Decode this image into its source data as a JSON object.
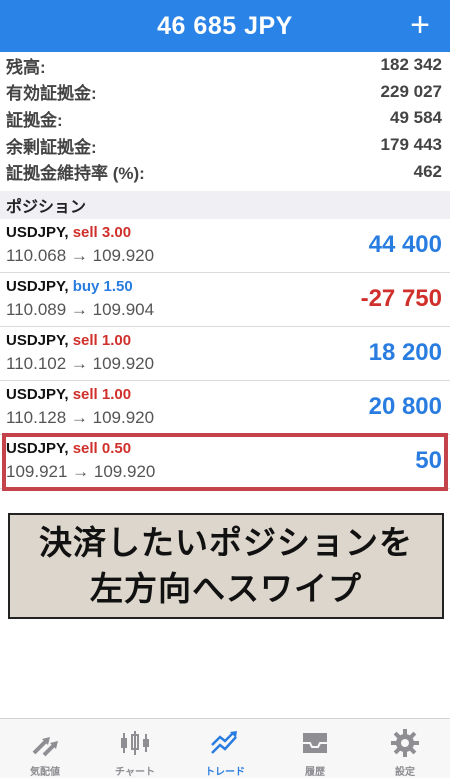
{
  "header": {
    "title": "46 685 JPY",
    "plus": "+"
  },
  "summary": [
    {
      "label": "残高:",
      "value": "182 342"
    },
    {
      "label": "有効証拠金:",
      "value": "229 027"
    },
    {
      "label": "証拠金:",
      "value": "49 584"
    },
    {
      "label": "余剰証拠金:",
      "value": "179 443"
    },
    {
      "label": "証拠金維持率 (%):",
      "value": "462"
    }
  ],
  "positions_header": "ポジション",
  "positions": [
    {
      "symbol": "USDJPY,",
      "side": "sell 3.00",
      "prices": "110.068 → 109.920",
      "profit": "44 400"
    },
    {
      "symbol": "USDJPY,",
      "side": "buy 1.50",
      "prices": "110.089 → 109.904",
      "profit": "-27 750"
    },
    {
      "symbol": "USDJPY,",
      "side": "sell 1.00",
      "prices": "110.102 → 109.920",
      "profit": "18 200"
    },
    {
      "symbol": "USDJPY,",
      "side": "sell 1.00",
      "prices": "110.128 → 109.920",
      "profit": "20 800"
    },
    {
      "symbol": "USDJPY,",
      "side": "sell 0.50",
      "prices": "109.921 → 109.920",
      "profit": "50"
    }
  ],
  "callout": {
    "line1": "決済したいポジションを",
    "line2": "左方向へスワイプ"
  },
  "tabs": [
    {
      "label": "気配値",
      "icon": "quotes-arrows-icon"
    },
    {
      "label": "チャート",
      "icon": "candlestick-chart-icon"
    },
    {
      "label": "トレード",
      "icon": "trade-trend-icon"
    },
    {
      "label": "履歴",
      "icon": "history-inbox-icon"
    },
    {
      "label": "設定",
      "icon": "gear-icon"
    }
  ],
  "colors": {
    "header": "#2a83e6",
    "sell": "#d0302b",
    "buy": "#2a7de0",
    "highlight": "#c4434a",
    "callout_bg": "#dcd6cc"
  }
}
